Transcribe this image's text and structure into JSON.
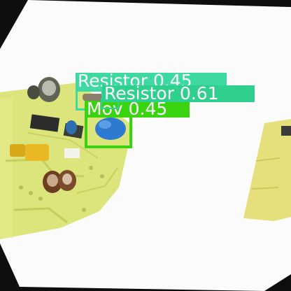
{
  "image": {
    "scene": "rotated photo of a green-yellow circuit board on white paper with object detection overlays",
    "background_color": "#0e0e0e",
    "paper_color": "#fbfbfb",
    "board_color": "#d9e27a"
  },
  "detections": [
    {
      "id": "det-resistor-1",
      "class_label": "Resistor",
      "confidence": "0.45",
      "color": "#3dd9a0"
    },
    {
      "id": "det-resistor-2",
      "class_label": "Resistor",
      "confidence": "0.61",
      "color": "#2fcf8e"
    },
    {
      "id": "det-mov",
      "class_label": "Mov",
      "confidence": "0.45",
      "color": "#39d40f"
    }
  ]
}
